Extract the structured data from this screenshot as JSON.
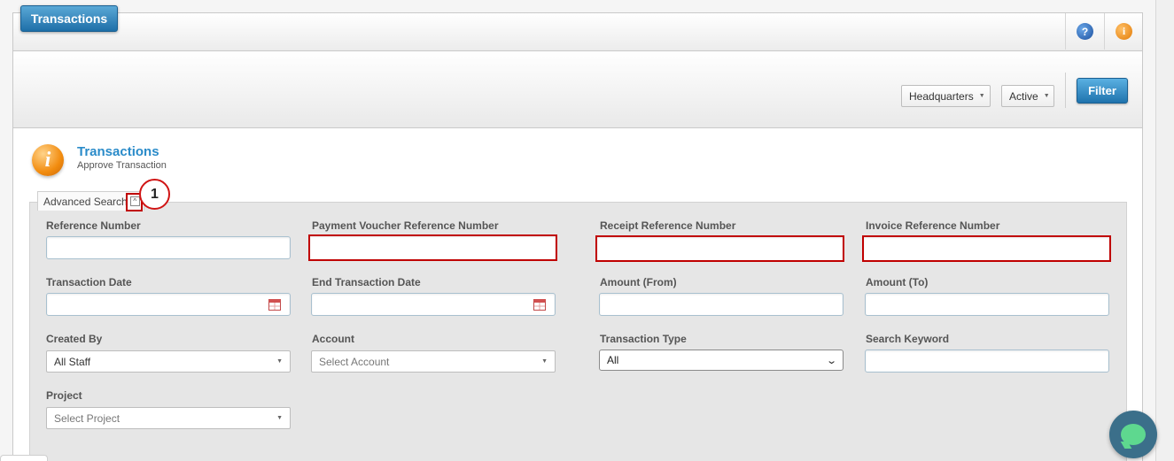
{
  "window": {
    "title": "Transactions"
  },
  "header_icons": {
    "help": "help-icon",
    "info": "info-icon",
    "help_glyph": "?",
    "info_glyph": "i"
  },
  "toolbar": {
    "location_dropdown": "Headquarters",
    "status_dropdown": "Active",
    "filter_label": "Filter"
  },
  "page": {
    "heading": "Transactions",
    "subheading": "Approve Transaction",
    "info_glyph": "i"
  },
  "advanced_search": {
    "tab_label": "Advanced Search",
    "collapse_glyph": "^",
    "step_marker": "1"
  },
  "fields": {
    "reference_number": {
      "label": "Reference Number",
      "value": ""
    },
    "payment_voucher_ref": {
      "label": "Payment Voucher Reference Number",
      "value": ""
    },
    "receipt_ref": {
      "label": "Receipt Reference Number",
      "value": ""
    },
    "invoice_ref": {
      "label": "Invoice Reference Number",
      "value": ""
    },
    "transaction_date": {
      "label": "Transaction Date",
      "value": ""
    },
    "end_transaction_date": {
      "label": "End Transaction Date",
      "value": ""
    },
    "amount_from": {
      "label": "Amount (From)",
      "value": ""
    },
    "amount_to": {
      "label": "Amount (To)",
      "value": ""
    },
    "created_by": {
      "label": "Created By",
      "value": "All Staff"
    },
    "account": {
      "label": "Account",
      "placeholder": "Select Account"
    },
    "transaction_type": {
      "label": "Transaction Type",
      "value": "All"
    },
    "search_keyword": {
      "label": "Search Keyword",
      "value": ""
    },
    "project": {
      "label": "Project",
      "placeholder": "Select Project"
    }
  },
  "colors": {
    "accent_blue": "#2a8bc9",
    "button_blue": "#1f73ad",
    "highlight_red": "#c00000",
    "chat_green": "#5ed88f"
  }
}
